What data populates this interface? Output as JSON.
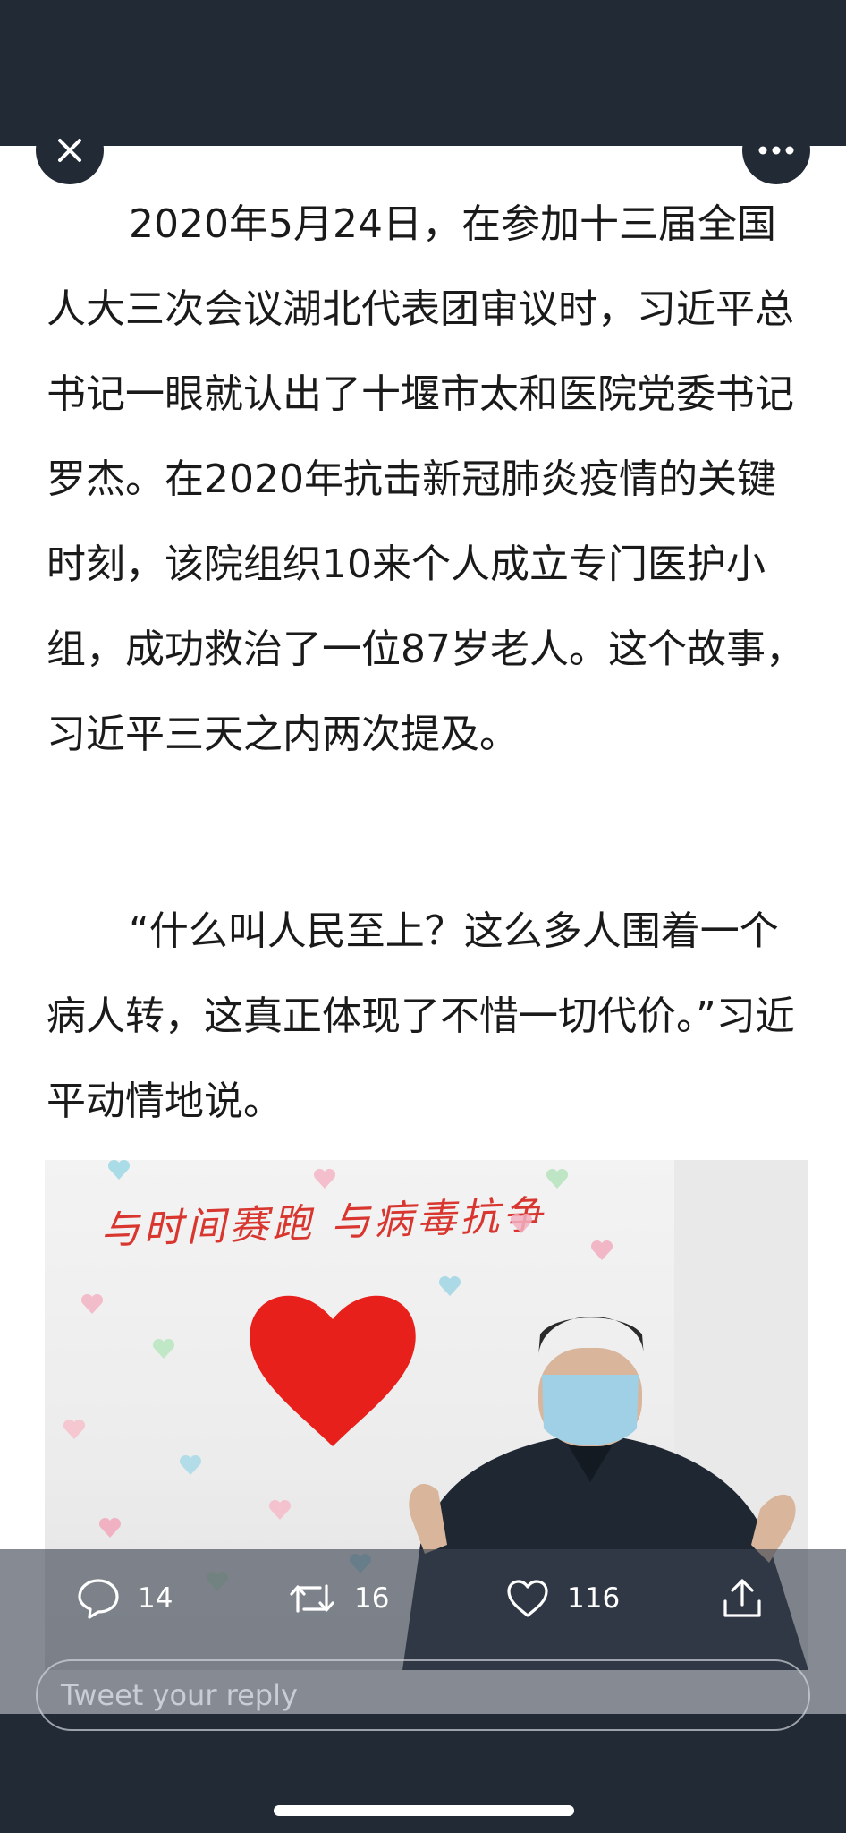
{
  "tweet": {
    "paragraph_1": "2020年5月24日，在参加十三届全国人大三次会议湖北代表团审议时，习近平总书记一眼就认出了十堰市太和医院党委书记罗杰。在2020年抗击新冠肺炎疫情的关键时刻，该院组织10来个人成立专门医护小组，成功救治了一位87岁老人。这个故事，习近平三天之内两次提及。",
    "paragraph_2": "“什么叫人民至上？这么多人围着一个病人转，这真正体现了不惜一切代价。”习近平动情地说。",
    "image": {
      "slogan": "与时间赛跑 与病毒抗争"
    }
  },
  "actions": {
    "reply_count": "14",
    "retweet_count": "16",
    "like_count": "116"
  },
  "reply_input": {
    "placeholder": "Tweet your reply"
  },
  "icons": {
    "close": "close-icon",
    "more": "more-icon",
    "reply": "comment-icon",
    "retweet": "retweet-icon",
    "like": "heart-icon",
    "share": "share-icon"
  },
  "colors": {
    "chrome_background": "#222a36",
    "heart_red": "#e8201c",
    "overlay": "rgba(60,68,80,0.62)"
  }
}
